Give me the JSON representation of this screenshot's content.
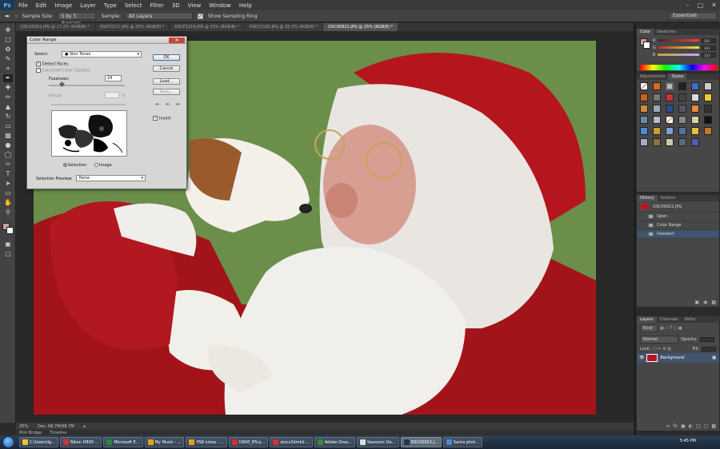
{
  "app": {
    "logo": "Ps"
  },
  "menu": [
    "File",
    "Edit",
    "Image",
    "Layer",
    "Type",
    "Select",
    "Filter",
    "3D",
    "View",
    "Window",
    "Help"
  ],
  "options": {
    "sample_size_label": "Sample Size:",
    "sample_size_value": "5 by 5 Average",
    "sample_label": "Sample:",
    "sample_value": "All Layers",
    "show_ring_label": "Show Sampling Ring",
    "workspace": "Essentials"
  },
  "tabs": [
    "DSC00301.JPG @ 17.2% (RGB/8) *",
    "DSCF2217.JPG @ 25% (RGB/8) *",
    "DSCF2216.JPG @ 25% (RGB/8) *",
    "DSCF2183.JPG @ 25.2% (RGB/8) *",
    "DSC00922.JPG @ 25% (RGB/8) *"
  ],
  "status": {
    "zoom": "25%",
    "doc": "Doc: 68.7M/68.7M"
  },
  "bottom_tabs": [
    "Mini Bridge",
    "Timeline"
  ],
  "dialog": {
    "title": "Color Range",
    "select_label": "Select:",
    "select_value": "Skin Tones",
    "detect_faces": "Detect Faces",
    "localized": "Localized Color Clusters",
    "fuzziness_label": "Fuzziness:",
    "fuzziness_value": "24",
    "range_label": "Range:",
    "range_unit": "%",
    "ok": "OK",
    "cancel": "Cancel",
    "load": "Load...",
    "save": "Save...",
    "invert": "Invert",
    "radio_selection": "Selection",
    "radio_image": "Image",
    "preview_label": "Selection Preview:",
    "preview_value": "None"
  },
  "color_panel": {
    "tabs": [
      "Color",
      "Swatches"
    ],
    "channels": [
      {
        "label": "R",
        "value": "201"
      },
      {
        "label": "G",
        "value": "161"
      },
      {
        "label": "B",
        "value": "153"
      }
    ]
  },
  "styles_panel": {
    "tabs": [
      "Adjustments",
      "Styles"
    ]
  },
  "history_panel": {
    "tabs": [
      "History",
      "Actions"
    ],
    "snapshot": "DSC00922.JPG",
    "items": [
      "Open",
      "Color Range",
      "Deselect"
    ]
  },
  "layers_panel": {
    "tabs": [
      "Layers",
      "Channels",
      "Paths"
    ],
    "kind": "Kind",
    "blend": "Normal",
    "opacity_label": "Opacity:",
    "lock_label": "Lock:",
    "fill_label": "Fill:",
    "layer_name": "Background"
  },
  "taskbar": {
    "items": [
      "C:\\Users\\lg...",
      "Nikon D800 ...",
      "Microsoft E...",
      "My Music - ...",
      "PS8 notes - ...",
      "D800_EN.p...",
      "stocs3dmkii-...",
      "Adobe Drea...",
      "Seasonic De...",
      "DSC00922.J...",
      "Santa phot..."
    ],
    "clock": "5:45 PM"
  },
  "colors": {
    "accent": "#41546e",
    "foreground": "#c9a199",
    "photo_bg": "#6a8f4a"
  }
}
